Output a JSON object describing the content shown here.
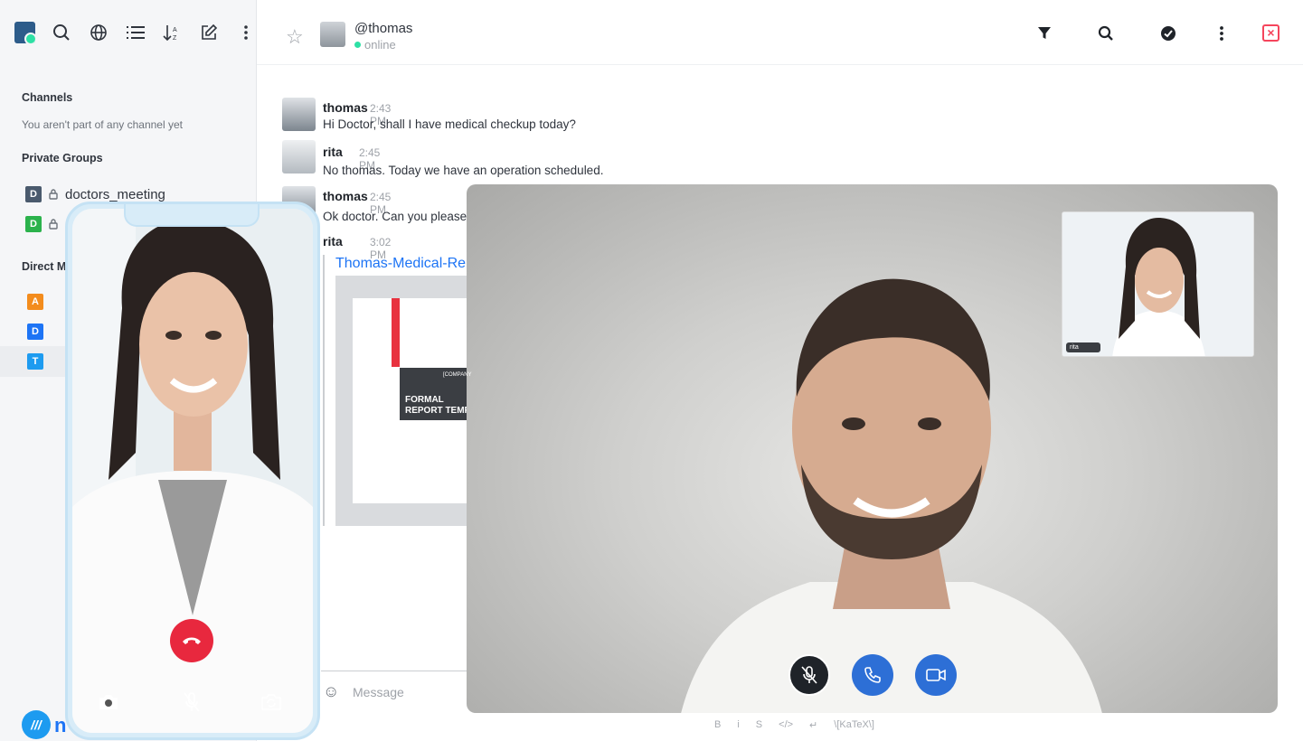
{
  "sidebar": {
    "channels_title": "Channels",
    "channels_empty": "You aren't part of any channel yet",
    "private_groups_title": "Private Groups",
    "groups": [
      {
        "initial": "D",
        "name": "doctors_meeting",
        "color": "#4a5a6d"
      },
      {
        "initial": "D",
        "name": "",
        "color": "#2bb24c"
      }
    ],
    "direct_title": "Direct Me",
    "direct": [
      {
        "initial": "A",
        "color": "#f38c1d"
      },
      {
        "initial": "D",
        "color": "#1d74f5"
      },
      {
        "initial": "T",
        "color": "#1d9bf0"
      }
    ],
    "brand_text": "n"
  },
  "header": {
    "username": "@thomas",
    "status": "online"
  },
  "messages": [
    {
      "author": "thomas",
      "time": "2:43 PM",
      "text": "Hi Doctor, shall I have medical checkup today?"
    },
    {
      "author": "rita",
      "time": "2:45 PM",
      "text": "No thomas. Today we have an operation scheduled."
    },
    {
      "author": "thomas",
      "time": "2:45 PM",
      "text": "Ok doctor. Can you please sh"
    },
    {
      "author": "rita",
      "time": "3:02 PM",
      "text": ""
    }
  ],
  "attachment": {
    "title": "Thomas-Medical-Rep",
    "doc_heading": "FORMAL\nREPORT TEMP",
    "doc_company": "[COMPANY"
  },
  "composer": {
    "placeholder": "Message",
    "format_items": [
      "B",
      "i",
      "S",
      "</>",
      "↵",
      "\\[KaTeX\\]"
    ]
  },
  "video_call": {
    "pip_label": "rita",
    "buttons": [
      "mute",
      "call",
      "video"
    ]
  },
  "colors": {
    "accent": "#1d74f5",
    "call_blue": "#2d6fd6",
    "end_call_red": "#e8283e",
    "close_red": "#f5455c"
  }
}
